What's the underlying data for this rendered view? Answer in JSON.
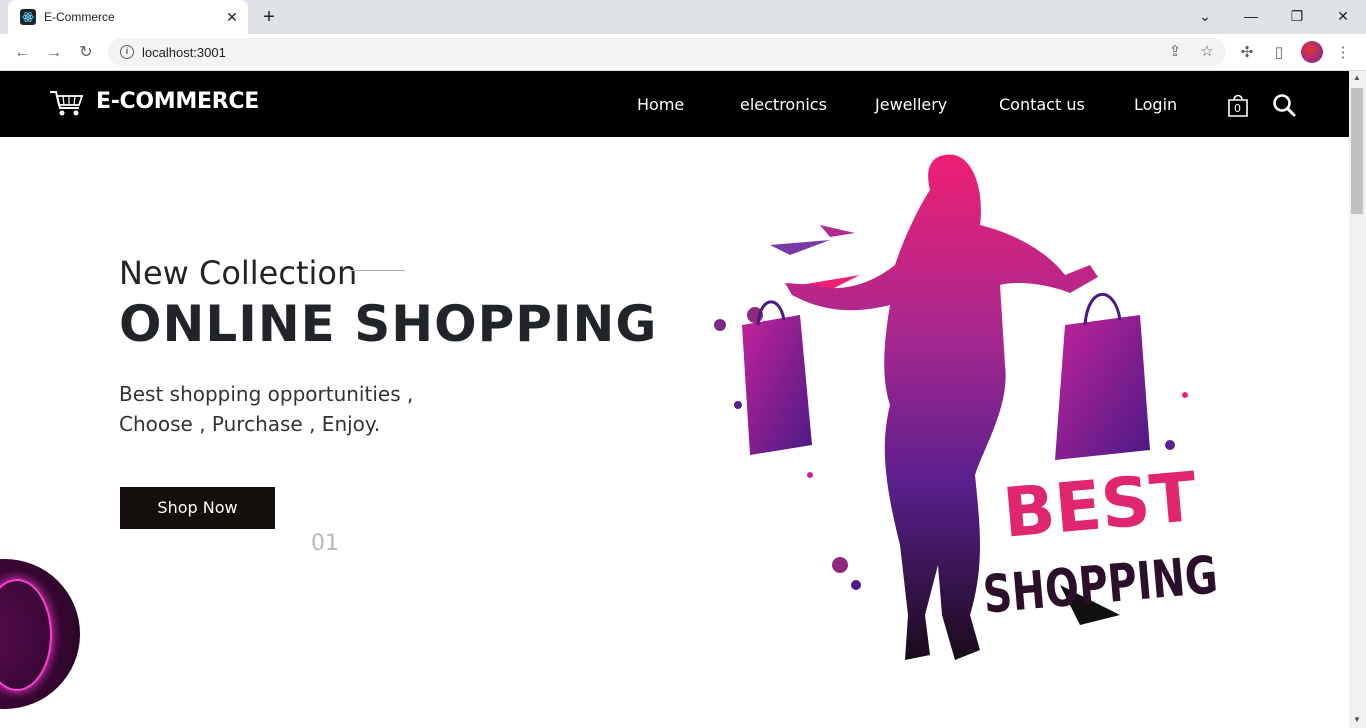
{
  "browser": {
    "tab_title": "E-Commerce",
    "url": "localhost:3001"
  },
  "site": {
    "logo": "E-COMMERCE",
    "nav": [
      "Home",
      "electronics",
      "Jewellery",
      "Contact us",
      "Login"
    ],
    "cart_count": "0"
  },
  "hero": {
    "subtitle": "New Collection",
    "title": "ONLINE SHOPPING",
    "text_line1": "Best shopping opportunities ,",
    "text_line2": "Choose , Purchase , Enjoy.",
    "button": "Shop Now",
    "slide_number": "01",
    "art_text_1": "BEST",
    "art_text_2": "SHOPPING"
  },
  "colors": {
    "header_bg": "#000000",
    "button_bg": "#140f0c",
    "accent_pink": "#e0266f",
    "accent_purple": "#5b1f8e"
  }
}
